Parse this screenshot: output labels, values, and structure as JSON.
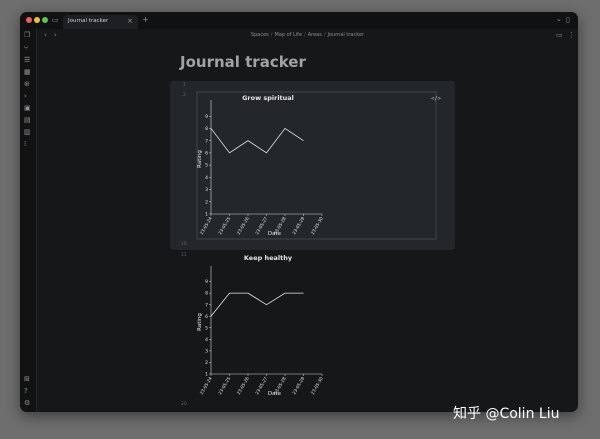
{
  "window": {
    "tab_title": "Journal tracker",
    "tab_close": "×",
    "new_tab": "+",
    "nav_back": "‹",
    "nav_forward": "›",
    "top_right_chevron": "⌄"
  },
  "breadcrumb": [
    "Spaces",
    "Map of Life",
    "Areas",
    "Journal tracker"
  ],
  "breadcrumb_separator": "/",
  "page": {
    "title": "Journal tracker",
    "code_toggle": "</>",
    "line_numbers": [
      "1",
      "2",
      "10",
      "11",
      "20"
    ]
  },
  "sidebar_icons": [
    "files-icon",
    "git-branch-icon",
    "list-icon",
    "calendar-icon",
    "graph-icon",
    "terminal-icon",
    "image-icon",
    "inbox-icon",
    "table-icon",
    "pin-icon",
    "help-icon",
    "settings-icon",
    "vault-icon"
  ],
  "watermark": "知乎 @Colin Liu",
  "colors": {
    "panel": "#23262b",
    "plot_border": "#4a4e54",
    "line": "#e6e6e6",
    "axis": "#d8d8d8",
    "axis_text": "#e6e6e6"
  },
  "chart_data": [
    {
      "type": "line",
      "title": "Grow spiritual",
      "xlabel": "Date",
      "ylabel": "Rating",
      "categories": [
        "23-05-24",
        "23-05-25",
        "23-05-26",
        "23-05-27",
        "23-05-28",
        "23-05-29",
        "23-05-30"
      ],
      "values": [
        8,
        6,
        7,
        6,
        8,
        7,
        null
      ],
      "ylim": [
        1,
        10
      ],
      "yticks": [
        1,
        2,
        3,
        4,
        5,
        6,
        7,
        8,
        9
      ],
      "grid": false
    },
    {
      "type": "line",
      "title": "Keep healthy",
      "xlabel": "Date",
      "ylabel": "Rating",
      "categories": [
        "23-05-24",
        "23-05-25",
        "23-05-26",
        "23-05-27",
        "23-05-28",
        "23-05-29",
        "23-05-30"
      ],
      "values": [
        6,
        8,
        8,
        7,
        8,
        8,
        null
      ],
      "ylim": [
        1,
        10
      ],
      "yticks": [
        1,
        2,
        3,
        4,
        5,
        6,
        7,
        8,
        9
      ],
      "grid": false
    }
  ]
}
